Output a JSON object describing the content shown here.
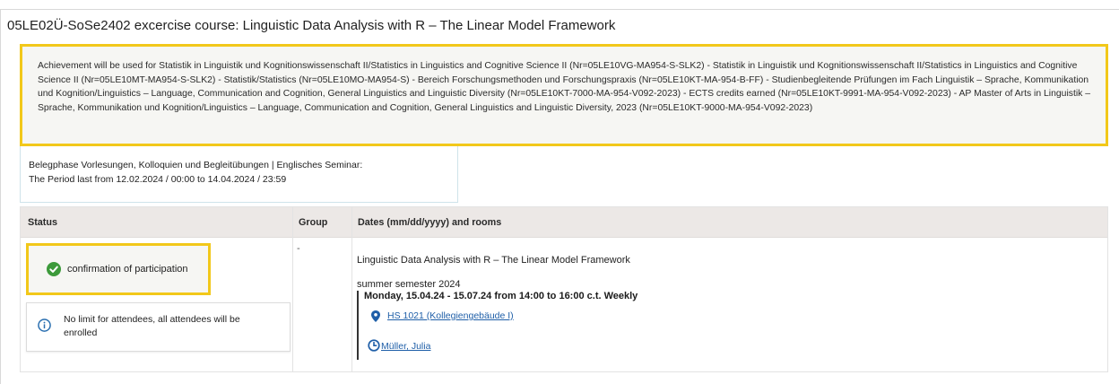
{
  "course": {
    "title": "05LE02Ü-SoSe2402 excercise course: Linguistic Data Analysis with R – The Linear Model Framework"
  },
  "achievement": {
    "text": "Achievement will be used for Statistik in Linguistik und Kognitionswissenschaft II/Statistics in Linguistics and Cognitive Science II (Nr=05LE10VG-MA954-S-SLK2) - Statistik in Linguistik und Kognitionswissenschaft II/Statistics in Linguistics and Cognitive Science II (Nr=05LE10MT-MA954-S-SLK2) - Statistik/Statistics (Nr=05LE10MO-MA954-S) - Bereich Forschungsmethoden und Forschungspraxis (Nr=05LE10KT-MA-954-B-FF) - Studienbegleitende Prüfungen im Fach Linguistik – Sprache, Kommunikation und Kognition/Linguistics – Language, Communication and Cognition, General Linguistics and Linguistic Diversity (Nr=05LE10KT-7000-MA-954-V092-2023) - ECTS credits earned (Nr=05LE10KT-9991-MA-954-V092-2023) - AP Master of Arts in Linguistik – Sprache, Kommunikation und Kognition/Linguistics – Language, Communication and Cognition, General Linguistics and Linguistic Diversity, 2023 (Nr=05LE10KT-9000-MA-954-V092-2023)"
  },
  "period": {
    "line1": "Belegphase Vorlesungen, Kolloquien und Begleitübungen | Englisches Seminar:",
    "line2": "The Period last from 12.02.2024 / 00:00 to 14.04.2024 / 23:59"
  },
  "table": {
    "headers": {
      "status": "Status",
      "group": "Group",
      "dates": "Dates (mm/dd/yyyy) and rooms"
    },
    "row": {
      "status_label": "confirmation of participation",
      "status_icon": "check-circle-icon",
      "info_text": "No limit for attendees, all attendees will be enrolled",
      "info_icon": "info-circle-icon",
      "group": "-",
      "event_title": "Linguistic Data Analysis with R – The Linear Model Framework",
      "semester": "summer semester 2024",
      "schedule": "Monday, 15.04.24 - 15.07.24 from 14:00 to 16:00 c.t. Weekly",
      "room": "HS 1021 (Kollegiengebäude I)",
      "room_icon": "location-pin-icon",
      "lecturer": "Müller, Julia",
      "lecturer_icon": "clock-icon"
    }
  },
  "colors": {
    "highlight_border": "#f2c81a",
    "link": "#1f5fa8",
    "success": "#3c9a3a",
    "info": "#2a6fb0",
    "header_bg": "#ece8e6"
  }
}
